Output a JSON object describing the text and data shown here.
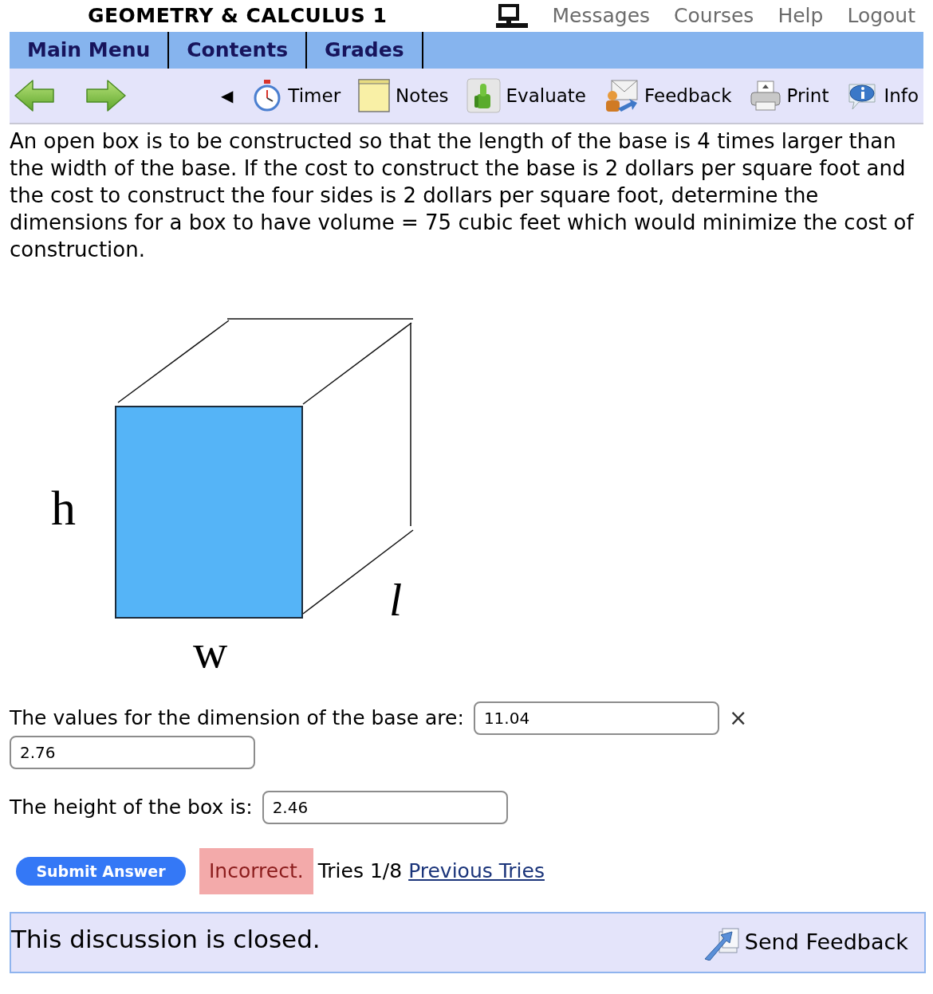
{
  "header": {
    "title": "GEOMETRY & CALCULUS 1",
    "links": [
      "Messages",
      "Courses",
      "Help",
      "Logout"
    ]
  },
  "menu_tabs": [
    "Main Menu",
    "Contents",
    "Grades"
  ],
  "toolbar": {
    "toggle": "◀",
    "tools": [
      {
        "kind": "timer",
        "label": "Timer"
      },
      {
        "kind": "notes",
        "label": "Notes"
      },
      {
        "kind": "evaluate",
        "label": "Evaluate"
      },
      {
        "kind": "feedback",
        "label": "Feedback"
      },
      {
        "kind": "print",
        "label": "Print"
      },
      {
        "kind": "info",
        "label": "Info"
      }
    ]
  },
  "question": {
    "text": "An open box is to be constructed so that the length of the base is 4 times larger than the width of the base. If the cost to construct the base is 2 dollars per square foot and the cost to construct the four sides is 2 dollars per square foot, determine the dimensions for a box to have volume = 75 cubic feet which would minimize the cost of construction.",
    "figure": {
      "height_label": "h",
      "width_label": "w",
      "length_label": "l"
    }
  },
  "answers": [
    {
      "prompt": "The values for the dimension of the base are:",
      "fields": [
        "11.04",
        "2.76"
      ],
      "mark": "×"
    },
    {
      "prompt": "The height of the box is:",
      "fields": [
        "2.46"
      ]
    }
  ],
  "submit": {
    "label": "Submit Answer"
  },
  "result": {
    "status": "Incorrect.",
    "tries": "Tries 1/8",
    "link": "Previous Tries"
  },
  "footer": {
    "message": "This discussion is closed.",
    "button": "Send Feedback"
  }
}
